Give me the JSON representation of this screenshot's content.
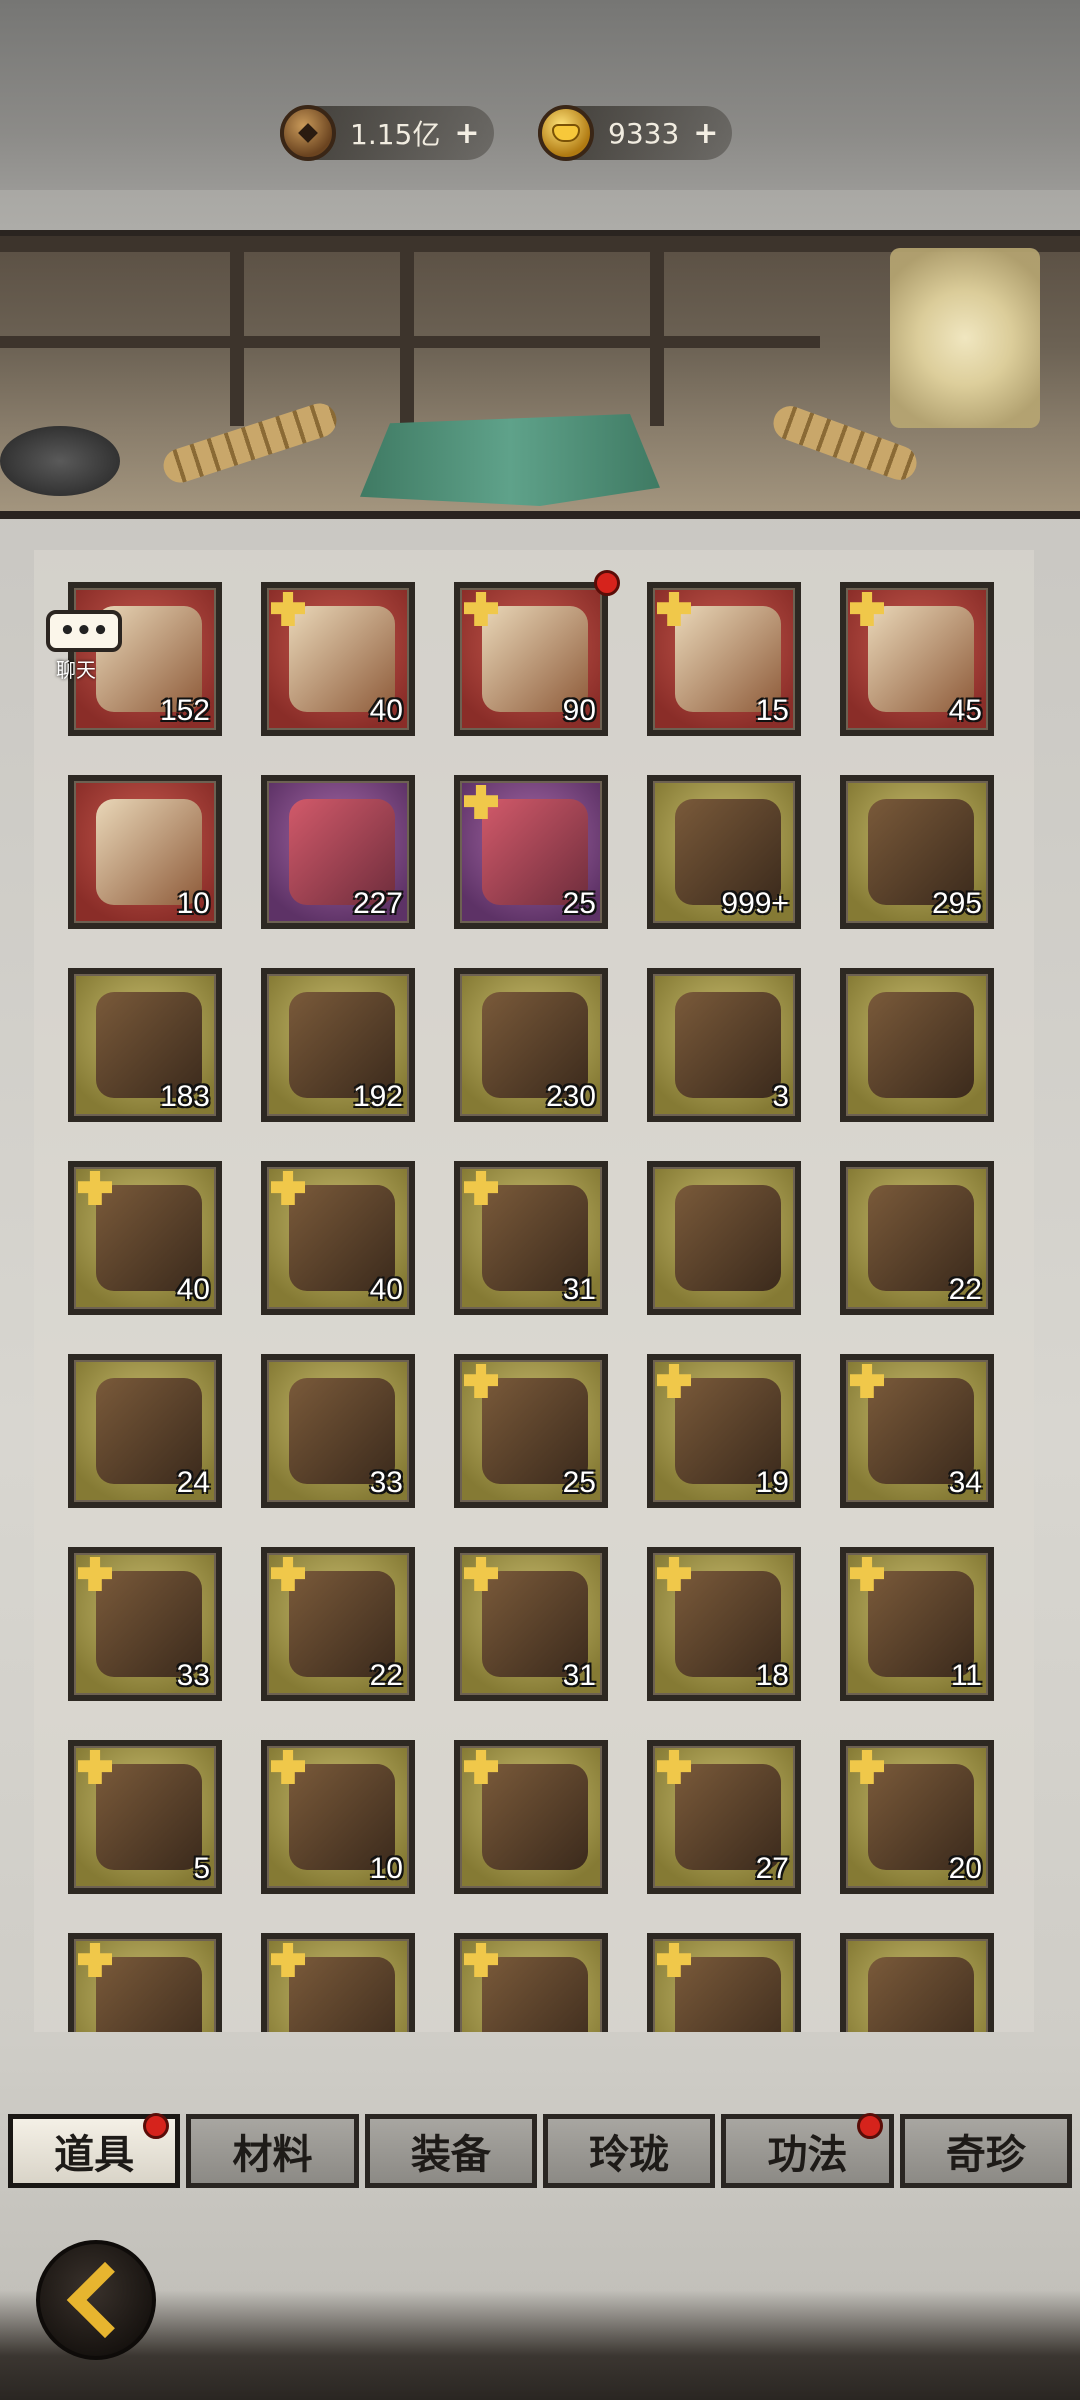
{
  "currency": {
    "copper": {
      "icon": "copper-coin-icon",
      "value": "1.15亿",
      "add": "+"
    },
    "gold": {
      "icon": "gold-ingot-icon",
      "value": "9333",
      "add": "+"
    }
  },
  "chat": {
    "dots": "•••",
    "label": "聊天"
  },
  "items": [
    {
      "count": "152",
      "color": "red",
      "star": false
    },
    {
      "count": "40",
      "color": "red",
      "star": true
    },
    {
      "count": "90",
      "color": "red",
      "star": true,
      "dot": true
    },
    {
      "count": "15",
      "color": "red",
      "star": true
    },
    {
      "count": "45",
      "color": "red",
      "star": true
    },
    {
      "count": "10",
      "color": "red",
      "star": false
    },
    {
      "count": "227",
      "color": "purple",
      "star": false
    },
    {
      "count": "25",
      "color": "purple",
      "star": true
    },
    {
      "count": "999+",
      "color": "olive",
      "star": false
    },
    {
      "count": "295",
      "color": "olive",
      "star": false
    },
    {
      "count": "183",
      "color": "olive",
      "star": false
    },
    {
      "count": "192",
      "color": "olive",
      "star": false
    },
    {
      "count": "230",
      "color": "olive",
      "star": false
    },
    {
      "count": "3",
      "color": "olive",
      "star": false
    },
    {
      "count": "",
      "color": "olive",
      "star": false
    },
    {
      "count": "40",
      "color": "olive",
      "star": true
    },
    {
      "count": "40",
      "color": "olive",
      "star": true
    },
    {
      "count": "31",
      "color": "olive",
      "star": true
    },
    {
      "count": "",
      "color": "olive",
      "star": false
    },
    {
      "count": "22",
      "color": "olive",
      "star": false
    },
    {
      "count": "24",
      "color": "olive",
      "star": false
    },
    {
      "count": "33",
      "color": "olive",
      "star": false
    },
    {
      "count": "25",
      "color": "olive",
      "star": true
    },
    {
      "count": "19",
      "color": "olive",
      "star": true
    },
    {
      "count": "34",
      "color": "olive",
      "star": true
    },
    {
      "count": "33",
      "color": "olive",
      "star": true
    },
    {
      "count": "22",
      "color": "olive",
      "star": true
    },
    {
      "count": "31",
      "color": "olive",
      "star": true
    },
    {
      "count": "18",
      "color": "olive",
      "star": true
    },
    {
      "count": "11",
      "color": "olive",
      "star": true
    },
    {
      "count": "5",
      "color": "olive",
      "star": true
    },
    {
      "count": "10",
      "color": "olive",
      "star": true
    },
    {
      "count": "",
      "color": "olive",
      "star": true
    },
    {
      "count": "27",
      "color": "olive",
      "star": true
    },
    {
      "count": "20",
      "color": "olive",
      "star": true
    },
    {
      "count": "",
      "color": "olive",
      "star": true
    },
    {
      "count": "",
      "color": "olive",
      "star": true
    },
    {
      "count": "",
      "color": "olive",
      "star": true
    },
    {
      "count": "",
      "color": "olive",
      "star": true
    },
    {
      "count": "",
      "color": "olive",
      "star": false
    }
  ],
  "tabs": [
    {
      "label": "道具",
      "active": true,
      "dot": true
    },
    {
      "label": "材料",
      "active": false,
      "dot": false
    },
    {
      "label": "装备",
      "active": false,
      "dot": false
    },
    {
      "label": "玲珑",
      "active": false,
      "dot": false
    },
    {
      "label": "功法",
      "active": false,
      "dot": true
    },
    {
      "label": "奇珍",
      "active": false,
      "dot": false
    }
  ],
  "back": {
    "icon": "back-arrow-icon"
  },
  "colors": {
    "slot_red": "#a8413a",
    "slot_purple": "#7e4a86",
    "slot_olive": "#a89c4e",
    "badge": "#f0c84a",
    "notify": "#d6231c",
    "accent": "#e7b52f"
  }
}
